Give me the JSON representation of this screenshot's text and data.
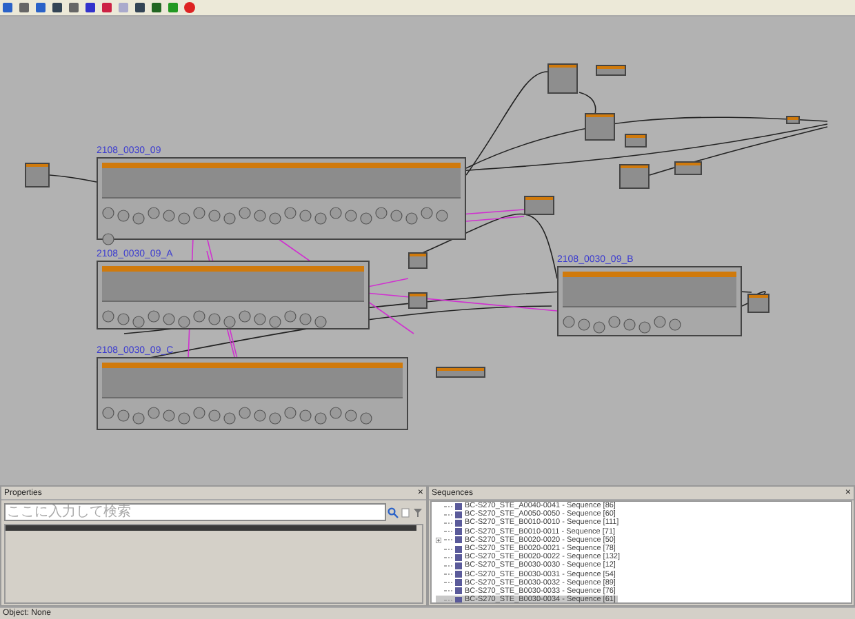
{
  "groups": [
    {
      "title": "2108_0030_09"
    },
    {
      "title": "2108_0030_09_A"
    },
    {
      "title": "2108_0030_09_B"
    },
    {
      "title": "2108_0030_09_C"
    }
  ],
  "properties": {
    "title": "Properties",
    "close": "×",
    "search": {
      "placeholder": "ここに入力して検索"
    }
  },
  "sequences": {
    "title": "Sequences",
    "close": "×",
    "items": [
      {
        "label": "BC-S270_STE_A0040-0041 - Sequence [86]",
        "has_children": false,
        "selected": false
      },
      {
        "label": "BC-S270_STE_A0050-0050 - Sequence [60]",
        "has_children": false,
        "selected": false
      },
      {
        "label": "BC-S270_STE_B0010-0010 - Sequence [111]",
        "has_children": false,
        "selected": false
      },
      {
        "label": "BC-S270_STE_B0010-0011 - Sequence [71]",
        "has_children": false,
        "selected": false
      },
      {
        "label": "BC-S270_STE_B0020-0020 - Sequence [50]",
        "has_children": true,
        "selected": false
      },
      {
        "label": "BC-S270_STE_B0020-0021 - Sequence [78]",
        "has_children": false,
        "selected": false
      },
      {
        "label": "BC-S270_STE_B0020-0022 - Sequence [132]",
        "has_children": false,
        "selected": false
      },
      {
        "label": "BC-S270_STE_B0030-0030 - Sequence [12]",
        "has_children": false,
        "selected": false
      },
      {
        "label": "BC-S270_STE_B0030-0031 - Sequence [54]",
        "has_children": false,
        "selected": false
      },
      {
        "label": "BC-S270_STE_B0030-0032 - Sequence [89]",
        "has_children": false,
        "selected": false
      },
      {
        "label": "BC-S270_STE_B0030-0033 - Sequence [76]",
        "has_children": false,
        "selected": false
      },
      {
        "label": "BC-S270_STE_B0030-0034 - Sequence [61]",
        "has_children": false,
        "selected": true
      }
    ]
  },
  "status_bar": {
    "text": "Object: None"
  }
}
